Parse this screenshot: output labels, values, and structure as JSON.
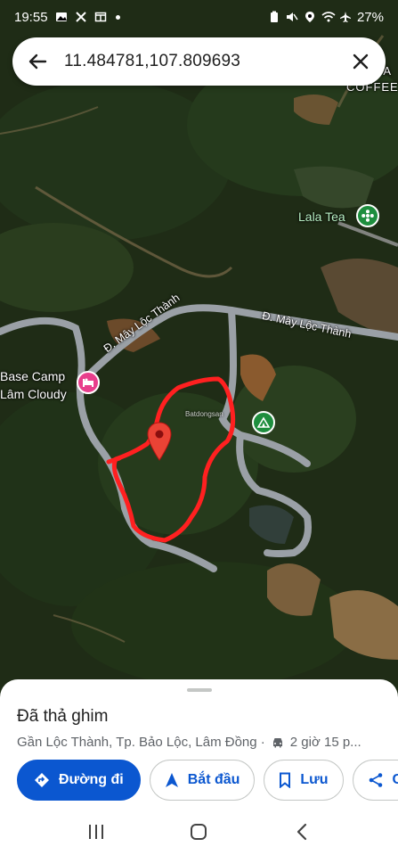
{
  "status_bar": {
    "time": "19:55",
    "battery": "27%",
    "left_icons": [
      "gallery-icon",
      "x-icon",
      "window-icon",
      "dot-icon"
    ],
    "right_icons": [
      "battery-saver-icon",
      "mute-icon",
      "location-icon",
      "wifi-icon",
      "airplane-icon"
    ]
  },
  "search": {
    "query": "11.484781,107.809693",
    "back_icon": "arrow-left-icon",
    "clear_icon": "close-icon"
  },
  "map": {
    "labels": {
      "coffee_partial": "CA",
      "coffee": "COFFEE",
      "lala_tea": "Lala Tea",
      "base_camp_line1": "Base Camp",
      "base_camp_line2": "Lâm Cloudy",
      "road_1": "Đ. Mây Lộc Thành",
      "road_2": "Đ. Mây Lộc Thành",
      "watermark": "Batdongsan"
    },
    "colors": {
      "boundary": "#ff2020",
      "pin": "#ea4335",
      "poi_tea": "#1e8e3e",
      "poi_hotel": "#e83e8c",
      "poi_camp": "#1e8e3e"
    }
  },
  "sheet": {
    "title": "Đã thả ghim",
    "subtitle": "Gần Lộc Thành, Tp. Bảo Lộc, Lâm Đồng ·",
    "drive_time": "2 giờ 15 p...",
    "buttons": {
      "directions": "Đường đi",
      "start": "Bắt đầu",
      "save": "Lưu",
      "share": "C"
    }
  },
  "nav": {
    "recent": "recents-icon",
    "home": "home-icon",
    "back": "back-icon"
  }
}
